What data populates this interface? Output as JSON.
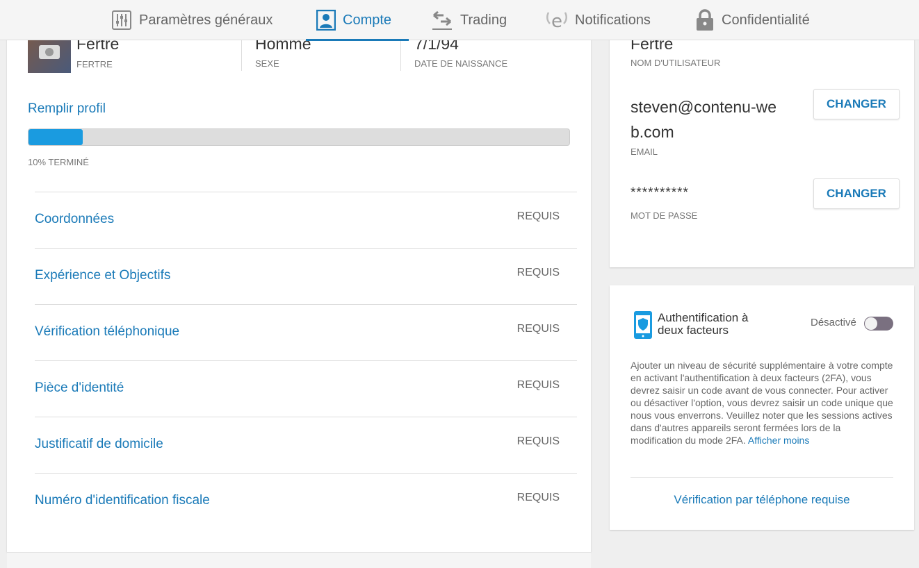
{
  "nav": {
    "tabs": [
      {
        "label": "Paramètres généraux",
        "icon": "sliders-icon"
      },
      {
        "label": "Compte",
        "icon": "user-icon",
        "active": true
      },
      {
        "label": "Trading",
        "icon": "arrows-exchange-icon"
      },
      {
        "label": "Notifications",
        "icon": "notification-e-icon"
      },
      {
        "label": "Confidentialité",
        "icon": "lock-icon"
      }
    ]
  },
  "profile": {
    "name": "Fertre",
    "name_label": "FERTRE",
    "sex": "Homme",
    "sex_label": "SEXE",
    "dob": "7/1/94",
    "dob_label": "DATE DE NAISSANCE",
    "fill_title": "Remplir profil",
    "progress_percent": 10,
    "progress_label": "10% TERMINÉ",
    "rows": [
      {
        "label": "Coordonnées",
        "status": "REQUIS"
      },
      {
        "label": "Expérience et Objectifs",
        "status": "REQUIS"
      },
      {
        "label": "Vérification téléphonique",
        "status": "REQUIS"
      },
      {
        "label": "Pièce d'identité",
        "status": "REQUIS"
      },
      {
        "label": "Justificatif de domicile",
        "status": "REQUIS"
      },
      {
        "label": "Numéro d'identification fiscale",
        "status": "REQUIS"
      }
    ]
  },
  "account": {
    "username": "Fertre",
    "username_label": "NOM D'UTILISATEUR",
    "email": "steven@contenu-web.com",
    "email_label": "EMAIL",
    "password": "**********",
    "password_label": "MOT DE PASSE",
    "change_label": "CHANGER"
  },
  "twofa": {
    "title": "Authentification à deux facteurs",
    "status": "Désactivé",
    "enabled": false,
    "description": "Ajouter un niveau de sécurité supplémentaire à votre compte en activant l'authentification à deux facteurs (2FA), vous devrez saisir un code avant de vous connecter. Pour activer ou désactiver l'option, vous devrez saisir un code unique que nous vous enverrons. Veuillez noter que les sessions actives dans d'autres appareils seront fermées lors de la modification du mode 2FA.",
    "show_less": "Afficher moins",
    "phone_required": "Vérification par téléphone requise"
  },
  "colors": {
    "accent": "#1a7ab8",
    "progress": "#1a9be0"
  }
}
